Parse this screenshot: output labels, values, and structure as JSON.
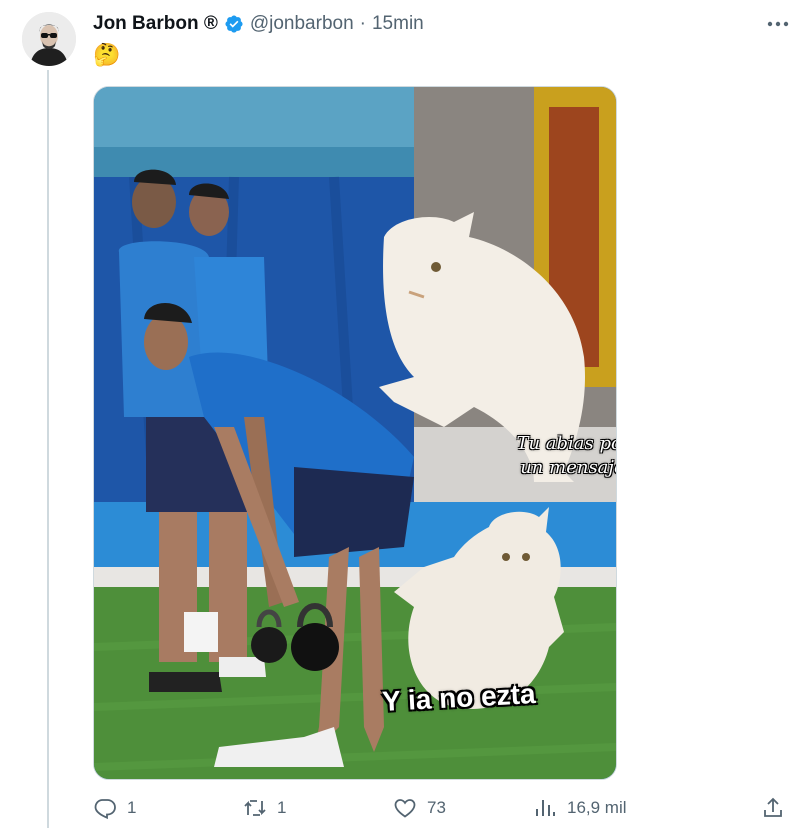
{
  "author": {
    "name": "Jon Barbon ®",
    "handle": "@jonbarbon",
    "separator": "·",
    "time": "15min"
  },
  "tweet": {
    "text": "🤔"
  },
  "media": {
    "caption_top": "Tu abias ponido un mensaje aki",
    "caption_bottom": "Y ia no ezta"
  },
  "actions": {
    "replies": "1",
    "retweets": "1",
    "likes": "73",
    "views": "16,9 mil"
  },
  "colors": {
    "verified": "#1d9bf0",
    "muted": "#536471",
    "thread_line": "#cfd9de"
  },
  "icons": [
    "more-icon",
    "verified-icon",
    "reply-icon",
    "retweet-icon",
    "like-icon",
    "views-icon",
    "share-icon"
  ]
}
